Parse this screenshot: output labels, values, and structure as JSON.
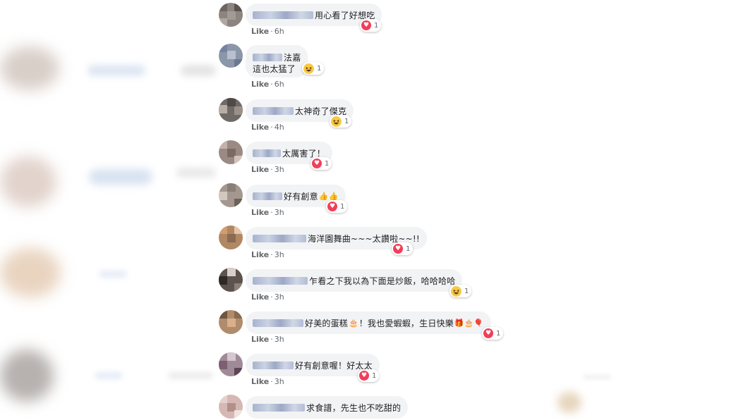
{
  "comments": [
    {
      "text": "用心看了好想吃",
      "reaction": "heart",
      "count": "1",
      "like": "Like",
      "sep": "·",
      "time": "6h"
    },
    {
      "line1": "法嘉",
      "line2": "這也太猛了",
      "reaction": "haha",
      "count": "1",
      "like": "Like",
      "sep": "·",
      "time": "6h"
    },
    {
      "text": "太神奇了傑克",
      "reaction": "haha",
      "count": "1",
      "like": "Like",
      "sep": "·",
      "time": "4h"
    },
    {
      "text": "太厲害了！",
      "reaction": "heart",
      "count": "1",
      "like": "Like",
      "sep": "·",
      "time": "3h"
    },
    {
      "text": "好有創意",
      "emoji_after": "👍👍",
      "reaction": "heart",
      "count": "1",
      "like": "Like",
      "sep": "·",
      "time": "3h"
    },
    {
      "text": "海洋園舞曲~~~太讚啦~~!!",
      "reaction": "heart",
      "count": "1",
      "like": "Like",
      "sep": "·",
      "time": "3h"
    },
    {
      "text": "乍看之下我以為下面是炒飯，哈哈哈哈",
      "reaction": "haha",
      "count": "1",
      "like": "Like",
      "sep": "·",
      "time": "3h"
    },
    {
      "text_a": "好美的蛋糕",
      "emoji_a": "🎂",
      "text_b": "！我也愛蝦蝦，生日快樂",
      "emoji_b": "🎁🎂🎈",
      "reaction": "heart",
      "count": "1",
      "like": "Like",
      "sep": "·",
      "time": "3h"
    },
    {
      "text": "好有創意喔！好太太",
      "reaction": "heart",
      "count": "1",
      "like": "Like",
      "sep": "·",
      "time": "3h"
    },
    {
      "text": "求食譜，先生也不吃甜的"
    }
  ],
  "colors": {
    "bubble": "#f2f3f5",
    "heart": "#f33e58",
    "haha": "#f7c945",
    "meta": "#606770"
  }
}
